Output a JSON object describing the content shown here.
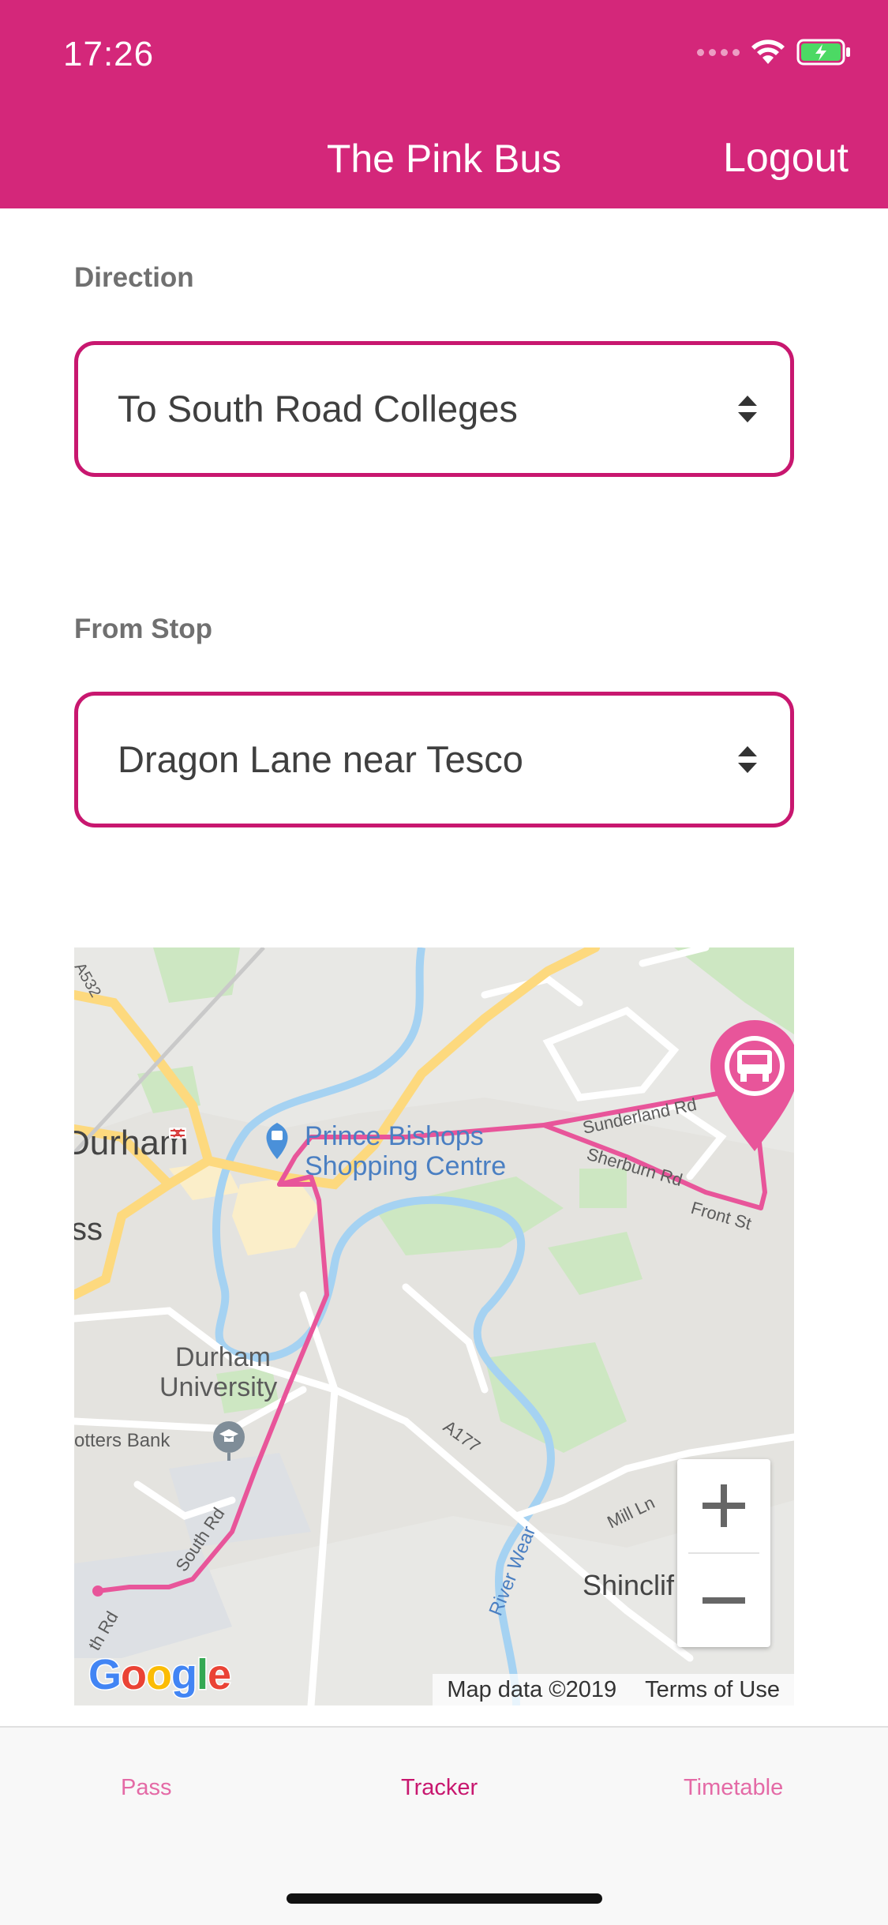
{
  "status_bar": {
    "time": "17:26"
  },
  "header": {
    "title": "The Pink Bus",
    "logout_label": "Logout"
  },
  "direction": {
    "label": "Direction",
    "selected": "To South Road Colleges"
  },
  "from_stop": {
    "label": "From Stop",
    "selected": "Dragon Lane near Tesco"
  },
  "map": {
    "places": {
      "durham": "Durham",
      "durham_university_1": "Durham",
      "durham_university_2": "University",
      "prince_bishops_1": "Prince Bishops",
      "prince_bishops_2": "Shopping Centre",
      "potters_bank": "otters Bank",
      "shincliffe": "Shinclif",
      "partial_ss": "ss",
      "partial_road": "A532"
    },
    "roads": {
      "sunderland_rd": "Sunderland Rd",
      "sherburn_rd": "Sherburn Rd",
      "front_st": "Front St",
      "a177": "A177",
      "river_wear": "River Wear",
      "mill_ln": "Mill Ln",
      "south_rd": "South Rd",
      "ath_rd": "th Rd"
    },
    "attribution": "Map data ©2019",
    "terms": "Terms of Use",
    "google": [
      "G",
      "o",
      "o",
      "g",
      "l",
      "e"
    ]
  },
  "tabs": [
    {
      "label": "Pass",
      "active": false
    },
    {
      "label": "Tracker",
      "active": true
    },
    {
      "label": "Timetable",
      "active": false
    }
  ],
  "colors": {
    "brand_pink": "#d4277a",
    "border_pink": "#c8176f",
    "route_pink": "#e8559a",
    "active_tab": "#c8176f",
    "inactive_tab": "#e46aa6"
  }
}
